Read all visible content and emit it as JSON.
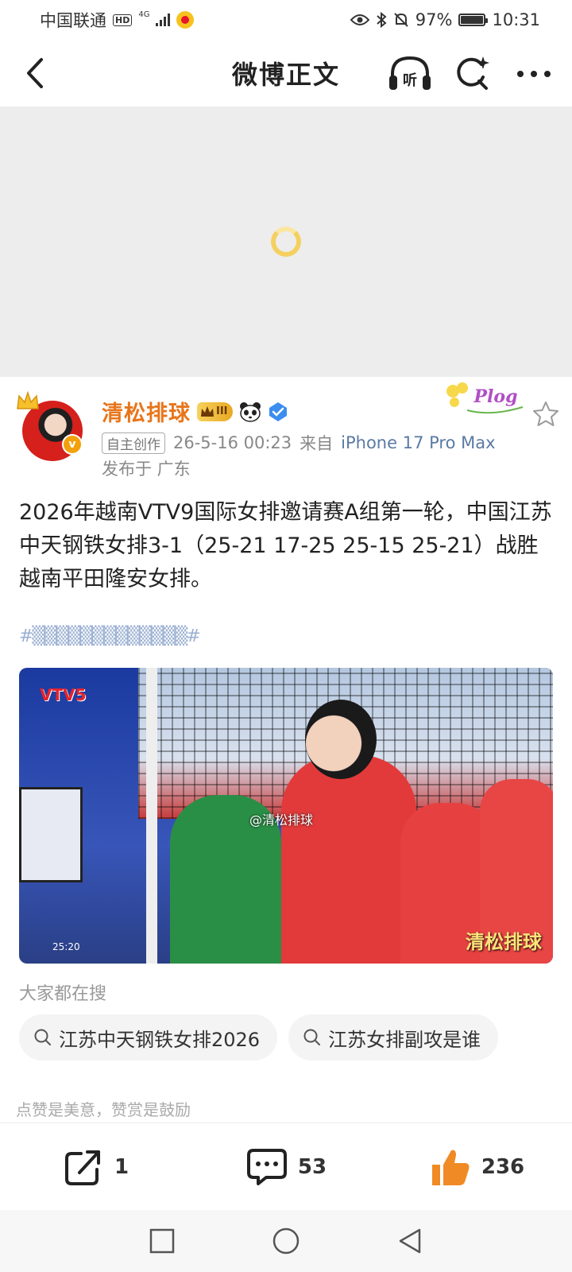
{
  "status_bar": {
    "carrier": "中国联通",
    "hd": "HD",
    "network": "4G",
    "battery": "97%",
    "time": "10:31"
  },
  "nav": {
    "title": "微博正文",
    "listen_label": "听"
  },
  "author": {
    "name": "清松排球",
    "vip_level": "III",
    "verified_mark": "v",
    "tag": "自主创作",
    "timestamp": "26-5-16 00:23",
    "source_prefix": "来自",
    "source": "iPhone 17 Pro Max",
    "location": "发布于 广东",
    "sticker_text": "Plog"
  },
  "post": {
    "text": "2026年越南VTV9国际女排邀请赛A组第一轮，中国江苏中天钢铁女排3-1（25-21 17-25 25-15 25-21）战胜越南平田隆安女排。",
    "image": {
      "logo": "VTV5",
      "watermark": "@清松排球",
      "corner_label": "清松排球",
      "timestamp": "25:20"
    }
  },
  "hot_search": {
    "title": "大家都在搜",
    "items": [
      "江苏中天钢铁女排2026",
      "江苏女排副攻是谁"
    ]
  },
  "reward_note": "点赞是美意，赞赏是鼓励",
  "actions": {
    "repost": "1",
    "comment": "53",
    "like": "236"
  },
  "colors": {
    "accent_orange": "#e8751a",
    "link_blue": "#5b7aa3",
    "like_orange": "#f08a24"
  }
}
